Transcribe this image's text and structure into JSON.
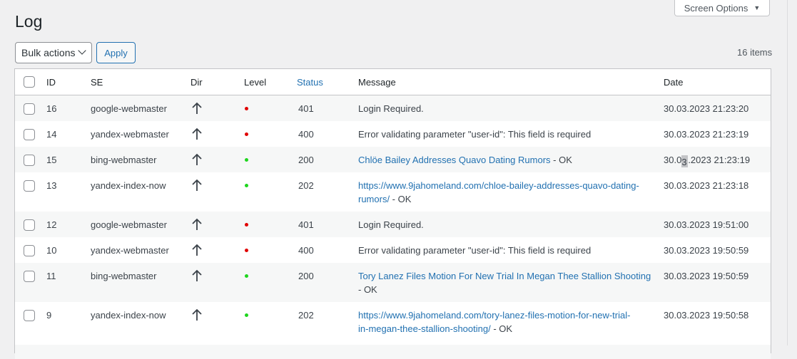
{
  "page": {
    "title": "Log"
  },
  "screen_options": {
    "label": "Screen Options"
  },
  "toolbar": {
    "bulk_actions": "Bulk actions",
    "apply": "Apply",
    "items_count": "16 items"
  },
  "columns": {
    "id": "ID",
    "se": "SE",
    "dir": "Dir",
    "level": "Level",
    "status": "Status",
    "message": "Message",
    "date": "Date"
  },
  "colors": {
    "accent": "#2271b1",
    "error_dot": "#e00000",
    "ok_dot": "#1ed51e"
  },
  "rows": [
    {
      "id": "16",
      "se": "google-webmaster",
      "dir_icon": "arrow-up-icon",
      "level": "error",
      "status": "401",
      "msg_link": "",
      "msg_link2": "",
      "msg_text": "Login Required.",
      "msg_text2": "",
      "date": "30.03.2023 21:23:20"
    },
    {
      "id": "14",
      "se": "yandex-webmaster",
      "dir_icon": "arrow-up-icon",
      "level": "error",
      "status": "400",
      "msg_link": "",
      "msg_link2": "",
      "msg_text": "Error validating parameter \"user-id\": This field is required",
      "msg_text2": "",
      "date": "30.03.2023 21:23:19"
    },
    {
      "id": "15",
      "se": "bing-webmaster",
      "dir_icon": "arrow-up-icon",
      "level": "ok",
      "status": "200",
      "msg_link": "Chlöe Bailey Addresses Quavo Dating Rumors",
      "msg_link2": "",
      "msg_text": " - OK",
      "msg_text2": "",
      "date_a": "30.0",
      "date_b": "3",
      "date_c": ".2023 21:23:19"
    },
    {
      "id": "13",
      "se": "yandex-index-now",
      "dir_icon": "arrow-up-icon",
      "level": "ok",
      "status": "202",
      "msg_link": "https://www.9jahomeland.com/chloe-bailey-addresses-quavo-dating-",
      "msg_link2": "rumors/",
      "msg_text": "",
      "msg_text2": " - OK",
      "date": "30.03.2023 21:23:18"
    },
    {
      "id": "12",
      "se": "google-webmaster",
      "dir_icon": "arrow-up-icon",
      "level": "error",
      "status": "401",
      "msg_link": "",
      "msg_link2": "",
      "msg_text": "Login Required.",
      "msg_text2": "",
      "date": "30.03.2023 19:51:00"
    },
    {
      "id": "10",
      "se": "yandex-webmaster",
      "dir_icon": "arrow-up-icon",
      "level": "error",
      "status": "400",
      "msg_link": "",
      "msg_link2": "",
      "msg_text": "Error validating parameter \"user-id\": This field is required",
      "msg_text2": "",
      "date": "30.03.2023 19:50:59"
    },
    {
      "id": "11",
      "se": "bing-webmaster",
      "dir_icon": "arrow-up-icon",
      "level": "ok",
      "status": "200",
      "msg_link": "Tory Lanez Files Motion For New Trial In Megan Thee Stallion Shooting",
      "msg_link2": "",
      "msg_text": "",
      "msg_text2": "- OK",
      "date": "30.03.2023 19:50:59"
    },
    {
      "id": "9",
      "se": "yandex-index-now",
      "dir_icon": "arrow-up-icon",
      "level": "ok",
      "status": "202",
      "msg_link": "https://www.9jahomeland.com/tory-lanez-files-motion-for-new-trial-",
      "msg_link2": "in-megan-thee-stallion-shooting/",
      "msg_text": "",
      "msg_text2": " - OK",
      "date": "30.03.2023 19:50:58"
    }
  ]
}
